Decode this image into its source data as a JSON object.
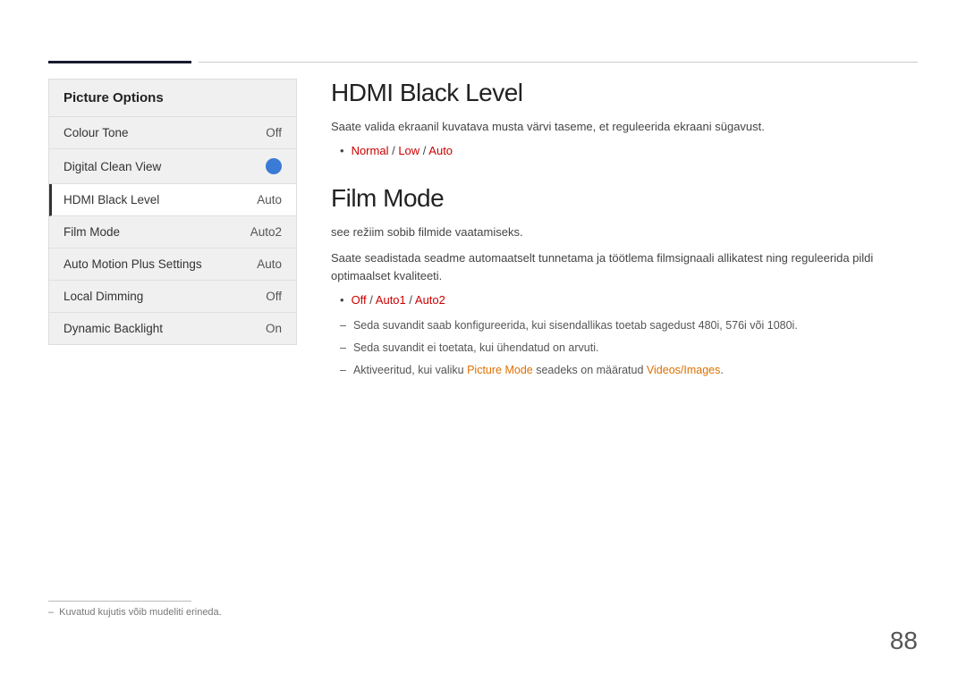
{
  "topbar": {
    "present": true
  },
  "sidebar": {
    "title": "Picture Options",
    "items": [
      {
        "label": "Colour Tone",
        "value": "Off",
        "type": "text",
        "active": false
      },
      {
        "label": "Digital Clean View",
        "value": "",
        "type": "toggle",
        "active": false
      },
      {
        "label": "HDMI Black Level",
        "value": "Auto",
        "type": "text",
        "active": true
      },
      {
        "label": "Film Mode",
        "value": "Auto2",
        "type": "text",
        "active": false
      },
      {
        "label": "Auto Motion Plus Settings",
        "value": "Auto",
        "type": "text",
        "active": false
      },
      {
        "label": "Local Dimming",
        "value": "Off",
        "type": "text",
        "active": false
      },
      {
        "label": "Dynamic Backlight",
        "value": "On",
        "type": "text",
        "active": false
      }
    ]
  },
  "hdmi_section": {
    "title": "HDMI Black Level",
    "description": "Saate valida ekraanil kuvatava musta värvi taseme, et reguleerida ekraani sügavust.",
    "options_prefix": "",
    "options": [
      {
        "text": "Normal",
        "color": "red"
      },
      {
        "text": " / ",
        "color": "normal"
      },
      {
        "text": "Low",
        "color": "red"
      },
      {
        "text": " / ",
        "color": "normal"
      },
      {
        "text": "Auto",
        "color": "red"
      }
    ]
  },
  "film_section": {
    "title": "Film Mode",
    "description1": "see režiim sobib filmide vaatamiseks.",
    "description2": "Saate seadistada seadme automaatselt tunnetama ja töötlema filmsignaali allikatest ning reguleerida pildi optimaalset kvaliteeti.",
    "options": [
      {
        "text": "Off",
        "color": "red"
      },
      {
        "text": " / ",
        "color": "normal"
      },
      {
        "text": "Auto1",
        "color": "red"
      },
      {
        "text": " / ",
        "color": "normal"
      },
      {
        "text": "Auto2",
        "color": "red"
      }
    ],
    "notes": [
      "Seda suvandit saab konfigureerida, kui sisendallikas toetab sagedust 480i, 576i või 1080i.",
      "Seda suvandit ei toetata, kui ühendatud on arvuti.",
      "Aktiveeritud, kui valiku Picture Mode seadeks on määratud Videos/Images."
    ],
    "note3_highlight1": "Picture Mode",
    "note3_highlight2": "Videos/Images"
  },
  "footnote": {
    "text": "Kuvatud kujutis võib mudeliti erineda."
  },
  "page_number": "88"
}
